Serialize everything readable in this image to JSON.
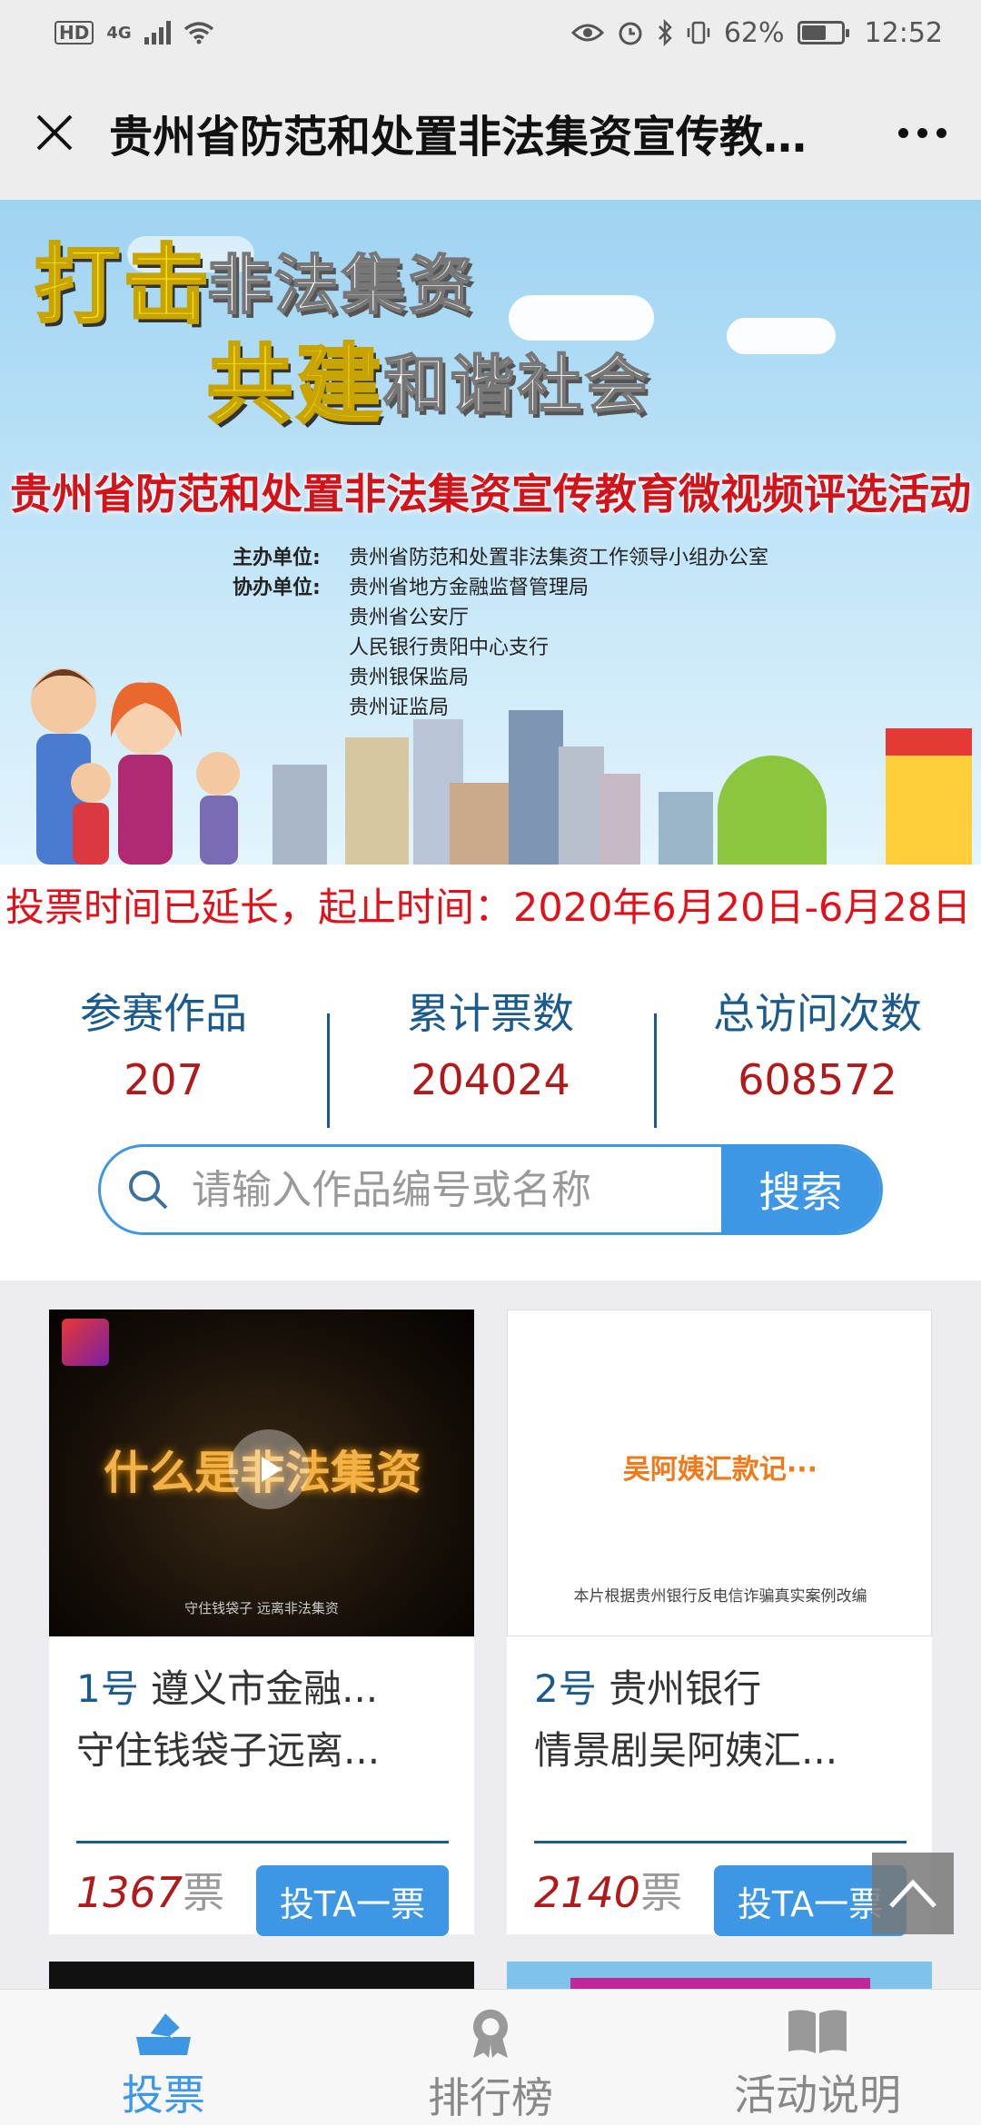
{
  "status_bar": {
    "hd": "HD",
    "network": "4G",
    "battery_percent": "62%",
    "battery_level": 0.62,
    "time": "12:52"
  },
  "header": {
    "title": "贵州省防范和处置非法集资宣传教育微视频评选活动"
  },
  "banner": {
    "slogan_line1_a": "打击",
    "slogan_line1_b": "非法集资",
    "slogan_line2_a": "共建",
    "slogan_line2_b": "和谐社会",
    "event_title": "贵州省防范和处置非法集资宣传教育微视频评选活动",
    "host_label": "主办单位:",
    "host": "贵州省防范和处置非法集资工作领导小组办公室",
    "co_label": "协办单位:",
    "co_orgs": [
      "贵州省地方金融监督管理局",
      "贵州省公安厅",
      "人民银行贵阳中心支行",
      "贵州银保监局",
      "贵州证监局"
    ]
  },
  "notice": "投票时间已延长，起止时间：2020年6月20日-6月28日",
  "stats": [
    {
      "label": "参赛作品",
      "value": "207"
    },
    {
      "label": "累计票数",
      "value": "204024"
    },
    {
      "label": "总访问次数",
      "value": "608572"
    }
  ],
  "search": {
    "placeholder": "请输入作品编号或名称",
    "button": "搜索"
  },
  "cards": [
    {
      "no": "1号",
      "line1": "遵义市金融...",
      "line2": "守住钱袋子远离...",
      "thumb_title": "什么是非法集资",
      "thumb_caption": "守住钱袋子 远离非法集资",
      "votes": "1367",
      "vote_unit": "票",
      "vote_button": "投TA一票"
    },
    {
      "no": "2号",
      "line1": "贵州银行",
      "line2": "情景剧吴阿姨汇...",
      "thumb_title": "吴阿姨汇款记···",
      "thumb_caption": "本片根据贵州银行反电信诈骗真实案例改编",
      "votes": "2140",
      "vote_unit": "票",
      "vote_button": "投TA一票"
    }
  ],
  "nav": [
    {
      "label": "投票",
      "icon": "vote-icon",
      "active": true
    },
    {
      "label": "排行榜",
      "icon": "medal-icon",
      "active": false
    },
    {
      "label": "活动说明",
      "icon": "book-icon",
      "active": false
    }
  ],
  "colors": {
    "accent": "#3d97e4",
    "navy": "#1a5a8c",
    "red": "#e0111a",
    "vote_red": "#b01a1a"
  }
}
